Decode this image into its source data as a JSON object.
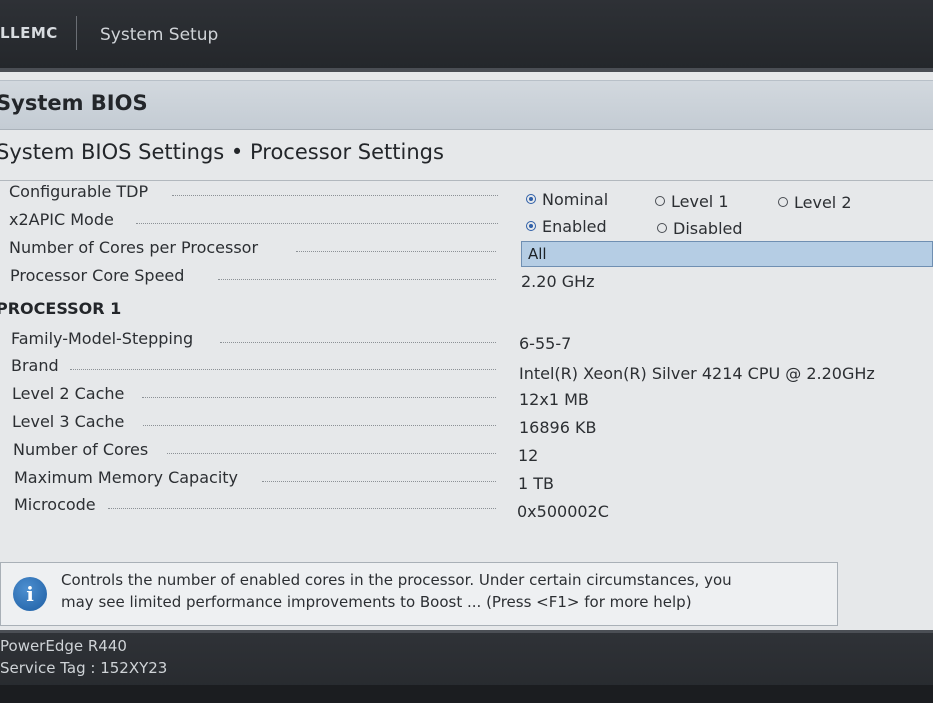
{
  "header": {
    "brand": "DELLEMC",
    "brand_visible": "LLEMC",
    "app_title": "System Setup"
  },
  "section": {
    "title": "System BIOS"
  },
  "page": {
    "subtitle": "System BIOS Settings • Processor Settings"
  },
  "settings": {
    "configurable_tdp": {
      "label": "Configurable TDP",
      "options": [
        "Nominal",
        "Level 1",
        "Level 2"
      ],
      "selected": "Nominal"
    },
    "x2apic_mode": {
      "label": "x2APIC Mode",
      "options": [
        "Enabled",
        "Disabled"
      ],
      "selected": "Enabled"
    },
    "cores_per_processor": {
      "label": "Number of Cores per Processor",
      "value": "All"
    },
    "core_speed": {
      "label": "Processor Core Speed",
      "value": "2.20 GHz"
    }
  },
  "processor1": {
    "heading": "PROCESSOR 1",
    "rows": [
      {
        "label": "Family-Model-Stepping",
        "value": "6-55-7"
      },
      {
        "label": "Brand",
        "value": "Intel(R) Xeon(R) Silver 4214 CPU @ 2.20GHz"
      },
      {
        "label": "Level 2 Cache",
        "value": "12x1 MB"
      },
      {
        "label": "Level 3 Cache",
        "value": "16896 KB"
      },
      {
        "label": "Number of Cores",
        "value": "12"
      },
      {
        "label": "Maximum Memory Capacity",
        "value": "1 TB"
      },
      {
        "label": "Microcode",
        "value": "0x500002C"
      }
    ]
  },
  "help": {
    "icon": "info-icon",
    "line1": "Controls the number of enabled cores in the processor. Under certain circumstances, you",
    "line2": "may see limited performance improvements to Boost ... (Press <F1> for more help)"
  },
  "footer": {
    "model": "PowerEdge R440",
    "service_tag": "Service Tag : 152XY23"
  },
  "colors": {
    "accent": "#2f5fa8",
    "selection": "#b5cde4",
    "chrome": "#2a2d32"
  }
}
